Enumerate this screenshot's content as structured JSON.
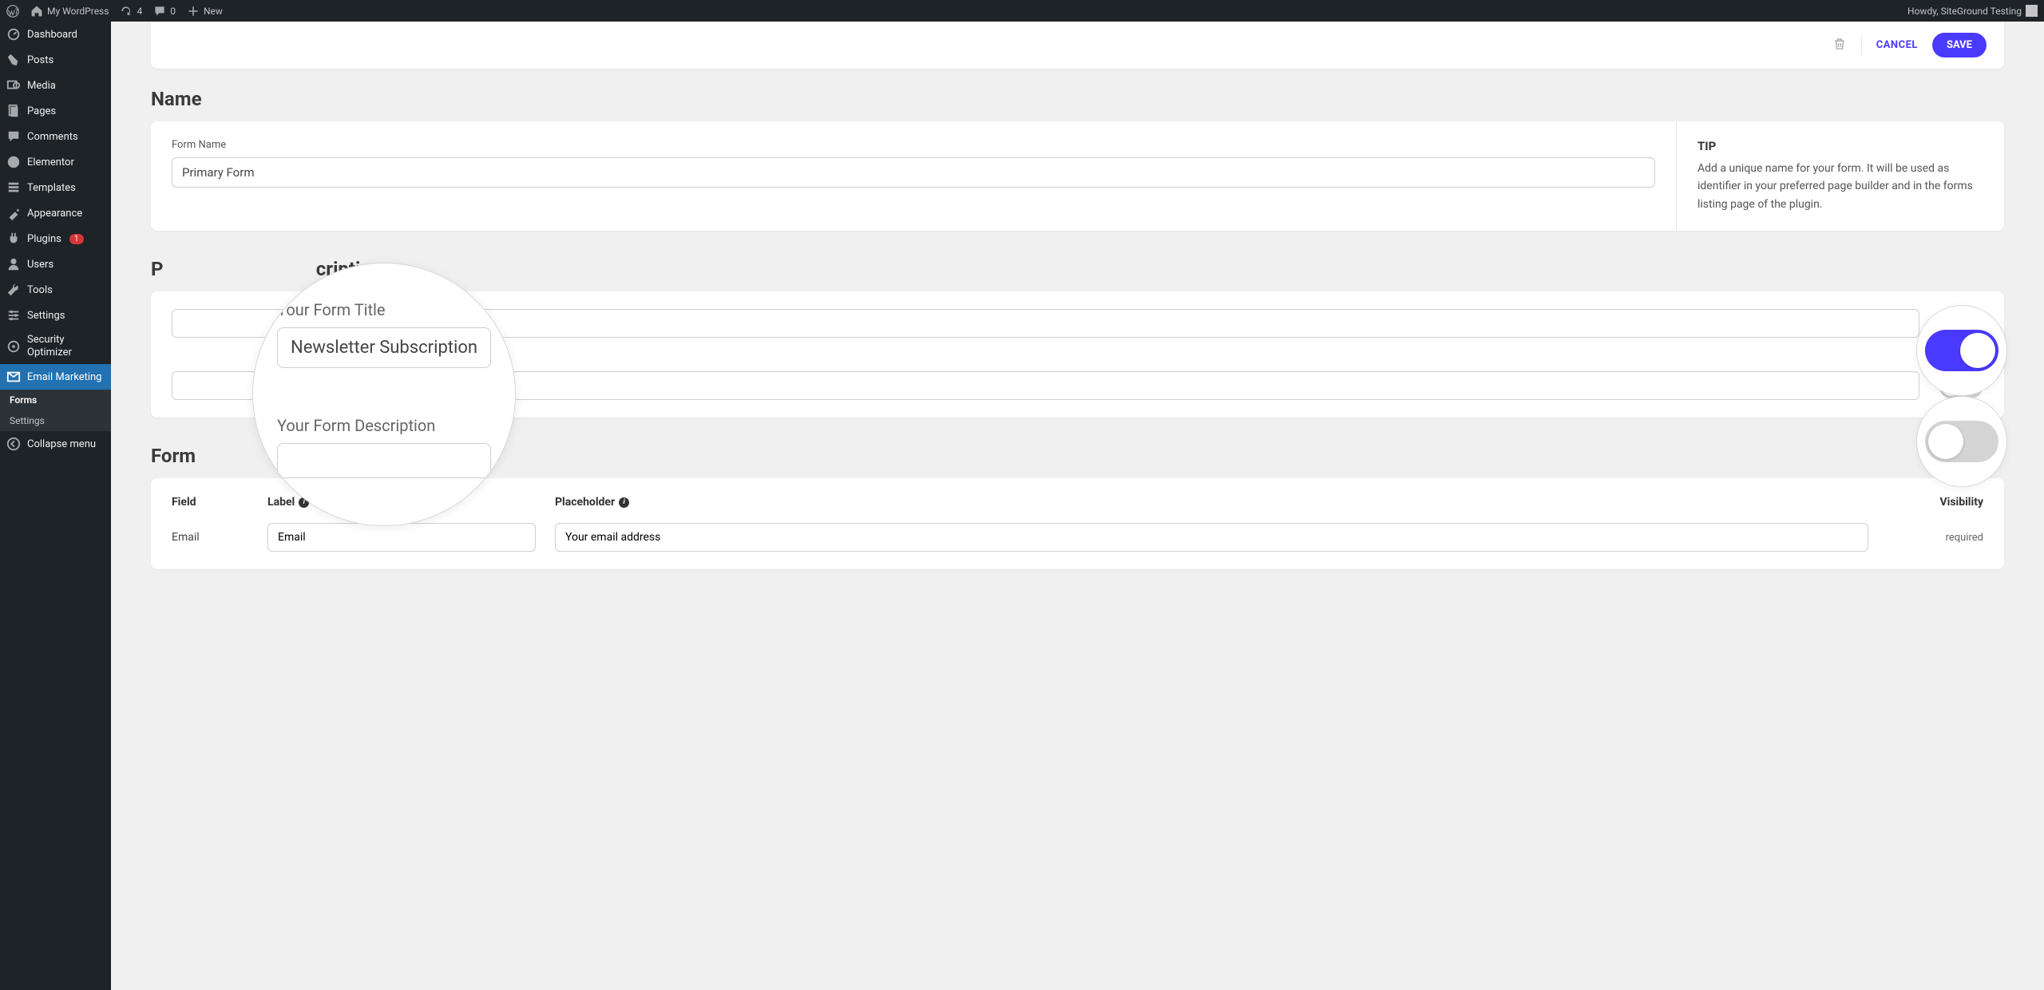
{
  "adminbar": {
    "site_name": "My WordPress",
    "updates": "4",
    "comments": "0",
    "new": "New",
    "howdy": "Howdy, SiteGround Testing"
  },
  "sidebar": {
    "items": [
      {
        "label": "Dashboard"
      },
      {
        "label": "Posts"
      },
      {
        "label": "Media"
      },
      {
        "label": "Pages"
      },
      {
        "label": "Comments"
      },
      {
        "label": "Elementor"
      },
      {
        "label": "Templates"
      },
      {
        "label": "Appearance"
      },
      {
        "label": "Plugins",
        "badge": "1"
      },
      {
        "label": "Users"
      },
      {
        "label": "Tools"
      },
      {
        "label": "Settings"
      },
      {
        "label": "Security Optimizer"
      },
      {
        "label": "Email Marketing"
      }
    ],
    "submenu": [
      {
        "label": "Forms",
        "active": true
      },
      {
        "label": "Settings",
        "active": false
      }
    ],
    "collapse": "Collapse menu"
  },
  "actions": {
    "cancel": "CANCEL",
    "save": "SAVE"
  },
  "name_section": {
    "title": "Name",
    "label": "Form Name",
    "value": "Primary Form",
    "tip_title": "TIP",
    "tip_text": "Add a unique name for your form. It will be used as identifier in your preferred page builder and in the forms listing page of the plugin."
  },
  "desc_section": {
    "title_partial_left": "P",
    "title_partial_right": "cription",
    "visible_hint": "Presentation & Description"
  },
  "zoom": {
    "title_label": "Your Form Title",
    "title_value": "Newsletter Subscription",
    "desc_label": "Your Form Description"
  },
  "fields_section": {
    "title_partial": "Form",
    "headers": {
      "field": "Field",
      "label": "Label",
      "placeholder": "Placeholder",
      "visibility": "Visibility"
    },
    "rows": [
      {
        "field": "Email",
        "label": "Email",
        "placeholder": "Your email address",
        "visibility": "required"
      }
    ]
  }
}
